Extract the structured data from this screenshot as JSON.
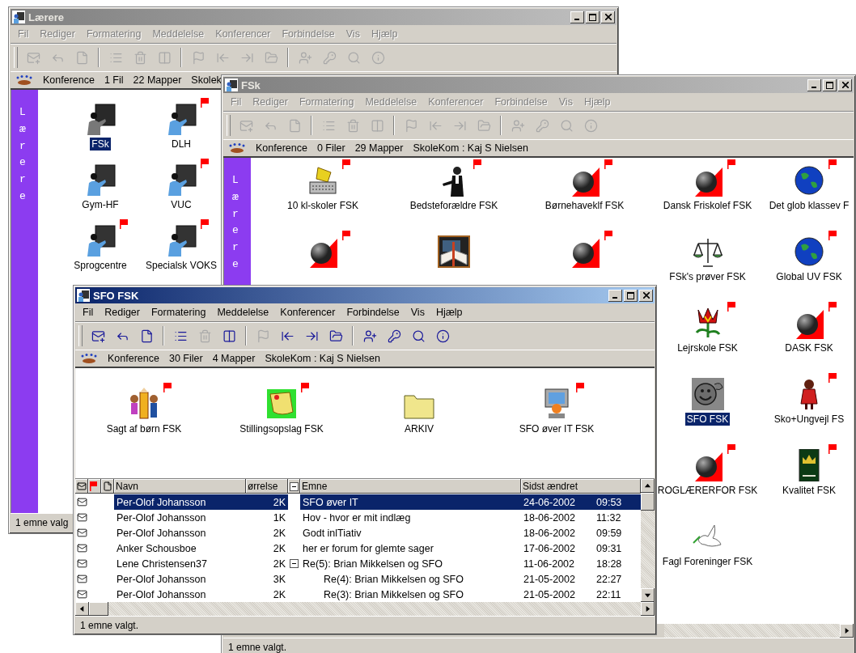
{
  "windows": [
    {
      "title": "Lærere",
      "active": false,
      "menu": [
        "Fil",
        "Rediger",
        "Formatering",
        "Meddelelse",
        "Konferencer",
        "Forbindelse",
        "Vis",
        "Hjælp"
      ],
      "toolbar": [
        [
          {
            "disabled": true
          },
          {
            "disabled": true
          },
          {
            "disabled": true
          }
        ],
        [
          {
            "disabled": true
          },
          {
            "disabled": true
          },
          {
            "disabled": true
          }
        ],
        [
          {
            "disabled": true
          },
          {
            "disabled": true
          },
          {
            "disabled": true
          },
          {
            "disabled": true
          }
        ],
        [
          {
            "disabled": true
          },
          {
            "disabled": true
          },
          {
            "disabled": true
          },
          {
            "disabled": true
          }
        ]
      ],
      "info": [
        "Konference",
        "1 Fil",
        "22 Mapper",
        "Skolek"
      ],
      "sidebar": "Lærere",
      "grid": {
        "rows": [
          {
            "items": [
              {
                "kind": "teacher",
                "label": "FSk",
                "flagged": false,
                "selected": true
              },
              {
                "kind": "teacher",
                "label": "DLH",
                "flagged": true,
                "selected": false
              }
            ]
          },
          {
            "items": [
              {
                "kind": "teacher",
                "label": "Gym-HF",
                "flagged": false,
                "selected": false
              },
              {
                "kind": "teacher",
                "label": "VUC",
                "flagged": true,
                "selected": false
              }
            ]
          },
          {
            "items": [
              {
                "kind": "teacher",
                "label": "Sprogcentre",
                "flagged": true,
                "selected": false
              },
              {
                "kind": "teacher",
                "label": "Specialsk VOKS",
                "flagged": true,
                "selected": false
              }
            ]
          }
        ]
      },
      "status": "1 emne valg"
    },
    {
      "title": "FSk",
      "active": false,
      "menu": [
        "Fil",
        "Rediger",
        "Formatering",
        "Meddelelse",
        "Konferencer",
        "Forbindelse",
        "Vis",
        "Hjælp"
      ],
      "toolbar": [
        [
          {
            "disabled": true
          },
          {
            "disabled": true
          },
          {
            "disabled": true
          }
        ],
        [
          {
            "disabled": true
          },
          {
            "disabled": true
          },
          {
            "disabled": true
          }
        ],
        [
          {
            "disabled": true
          },
          {
            "disabled": true
          },
          {
            "disabled": true
          },
          {
            "disabled": true
          }
        ],
        [
          {
            "disabled": true
          },
          {
            "disabled": true
          },
          {
            "disabled": true
          },
          {
            "disabled": true
          }
        ]
      ],
      "info": [
        "Konference",
        "0 Filer",
        "29 Mapper",
        "SkoleKom : Kaj S Nielsen"
      ],
      "sidebar": "Lærere",
      "grid": {
        "rows": [
          {
            "items": [
              {
                "kind": "fax",
                "label": "10 kl-skoler FSK",
                "flagged": true,
                "selected": false
              },
              {
                "kind": "butler",
                "label": "Bedsteforældre FSK",
                "flagged": true,
                "selected": false
              },
              {
                "kind": "ball",
                "label": "Børnehaveklf FSK",
                "flagged": true,
                "selected": false
              },
              {
                "kind": "ball",
                "label": "Dansk Friskolef FSK",
                "flagged": true,
                "selected": false
              },
              {
                "kind": "globe",
                "label": "Det glob klassev F",
                "flagged": true,
                "selected": false
              }
            ]
          },
          {
            "items": [
              {
                "kind": "ball",
                "flagged": true
              },
              {
                "kind": "book"
              },
              {
                "kind": "ball",
                "flagged": true
              },
              {
                "kind": "scales",
                "label": "FSk's prøver FSK",
                "flagged": false,
                "selected": false
              },
              {
                "kind": "globe",
                "label": "Global UV FSK",
                "flagged": true,
                "selected": false
              }
            ]
          },
          {
            "items": [
              {
                "kind": "empty"
              },
              {
                "kind": "empty"
              },
              {
                "kind": "empty"
              },
              {
                "kind": "flower",
                "label": "Lejrskole FSK",
                "flagged": true,
                "selected": false
              },
              {
                "kind": "ball",
                "label": "DASK FSK",
                "flagged": true,
                "selected": false
              }
            ]
          },
          {
            "items": [
              {
                "kind": "empty"
              },
              {
                "kind": "empty"
              },
              {
                "kind": "empty"
              },
              {
                "kind": "smiley",
                "label": "SFO FSK",
                "flagged": false,
                "selected": true
              },
              {
                "kind": "girl",
                "label": "Sko+Ungvejl FS",
                "flagged": true,
                "selected": false
              }
            ]
          },
          {
            "items": [
              {
                "kind": "empty"
              },
              {
                "kind": "empty"
              },
              {
                "kind": "empty"
              },
              {
                "kind": "ball",
                "label": "ROGLÆRERFOR FSK",
                "flagged": true,
                "selected": false
              },
              {
                "kind": "crown",
                "label": "Kvalitet FSK",
                "flagged": true,
                "selected": false
              }
            ]
          },
          {
            "items": [
              {
                "kind": "empty"
              },
              {
                "kind": "empty"
              },
              {
                "kind": "empty"
              },
              {
                "kind": "dove",
                "label": "Fagl Foreninger FSK",
                "flagged": false,
                "selected": false
              }
            ]
          }
        ]
      },
      "status": "1 emne valgt."
    },
    {
      "title": "SFO FSK",
      "active": true,
      "menu": [
        "Fil",
        "Rediger",
        "Formatering",
        "Meddelelse",
        "Konferencer",
        "Forbindelse",
        "Vis",
        "Hjælp"
      ],
      "toolbar": [
        [
          {
            "disabled": false
          },
          {
            "disabled": false
          },
          {
            "disabled": false
          }
        ],
        [
          {
            "disabled": false
          },
          {
            "disabled": true
          },
          {
            "disabled": false
          }
        ],
        [
          {
            "disabled": true
          },
          {
            "disabled": false
          },
          {
            "disabled": false
          },
          {
            "disabled": false
          }
        ],
        [
          {
            "disabled": false
          },
          {
            "disabled": false
          },
          {
            "disabled": false
          },
          {
            "disabled": false
          }
        ]
      ],
      "info": [
        "Konference",
        "30 Filer",
        "4 Mapper",
        "SkoleKom : Kaj S Nielsen"
      ],
      "grid": {
        "rows": [
          {
            "items": [
              {
                "kind": "kids",
                "label": "Sagt af børn FSK",
                "flagged": true,
                "selected": false
              },
              {
                "kind": "note",
                "label": "Stillingsopslag FSK",
                "flagged": true,
                "selected": false
              },
              {
                "kind": "folder",
                "label": "ARKIV",
                "flagged": false,
                "selected": false
              },
              {
                "kind": "computer",
                "label": "SFO øver IT FSK",
                "flagged": true,
                "selected": false
              }
            ]
          }
        ]
      },
      "table": {
        "columns": [
          "Navn",
          "ørrelse",
          "Emne",
          "Sidst ændret"
        ],
        "rows": [
          {
            "name": "Per-Olof Johansson",
            "size": "2K",
            "subject": "SFO øver IT",
            "date": "24-06-2002",
            "time": "09:53",
            "selected": true
          },
          {
            "name": "Per-Olof Johansson",
            "size": "1K",
            "subject": "Hov - hvor er mit indlæg",
            "date": "18-06-2002",
            "time": "11:32",
            "selected": false
          },
          {
            "name": "Per-Olof Johansson",
            "size": "2K",
            "subject": "Godt inlTiativ",
            "date": "18-06-2002",
            "time": "09:59",
            "selected": false
          },
          {
            "name": "Anker Schousboe",
            "size": "2K",
            "subject": "her er forum for glemte sager",
            "date": "17-06-2002",
            "time": "09:31",
            "selected": false
          },
          {
            "name": "Lene Christensen37",
            "size": "2K",
            "subject": "Re(5): Brian Mikkelsen og SFO",
            "date": "11-06-2002",
            "time": "18:28",
            "selected": false,
            "expanded": true,
            "children": [
              {
                "name": "Per-Olof Johansson",
                "size": "3K",
                "subject": "Re(4): Brian Mikkelsen og SFO",
                "date": "21-05-2002",
                "time": "22:27",
                "selected": false
              },
              {
                "name": "Per-Olof Johansson",
                "size": "2K",
                "subject": "Re(3): Brian Mikkelsen og SFO",
                "date": "21-05-2002",
                "time": "22:11",
                "selected": false
              }
            ]
          }
        ]
      },
      "status": "1 emne valgt."
    }
  ]
}
